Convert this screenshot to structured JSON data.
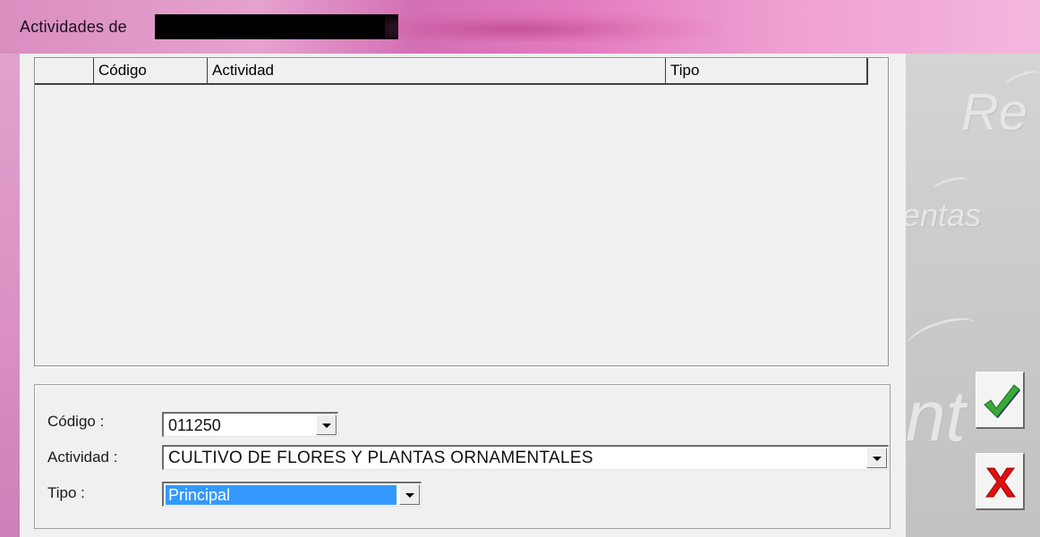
{
  "window": {
    "title": "Actividades de"
  },
  "grid": {
    "columns": [
      "Código",
      "Actividad",
      "Tipo"
    ],
    "rows": []
  },
  "form": {
    "codigo_label": "Código :",
    "codigo_value": "011250",
    "actividad_label": "Actividad :",
    "actividad_value": "CULTIVO DE FLORES Y PLANTAS ORNAMENTALES",
    "tipo_label": "Tipo :",
    "tipo_value": "Principal"
  },
  "side_panel": {
    "watermark_1": "Re",
    "watermark_2": "entas",
    "watermark_3": "nt"
  },
  "buttons": {
    "ok_icon": "green-checkmark-icon",
    "cancel_icon": "red-x-icon"
  },
  "colors": {
    "titlebar": "#e27bbe",
    "selection": "#3399ff",
    "ok_green": "#2e9a2e",
    "cancel_red": "#e01010"
  }
}
